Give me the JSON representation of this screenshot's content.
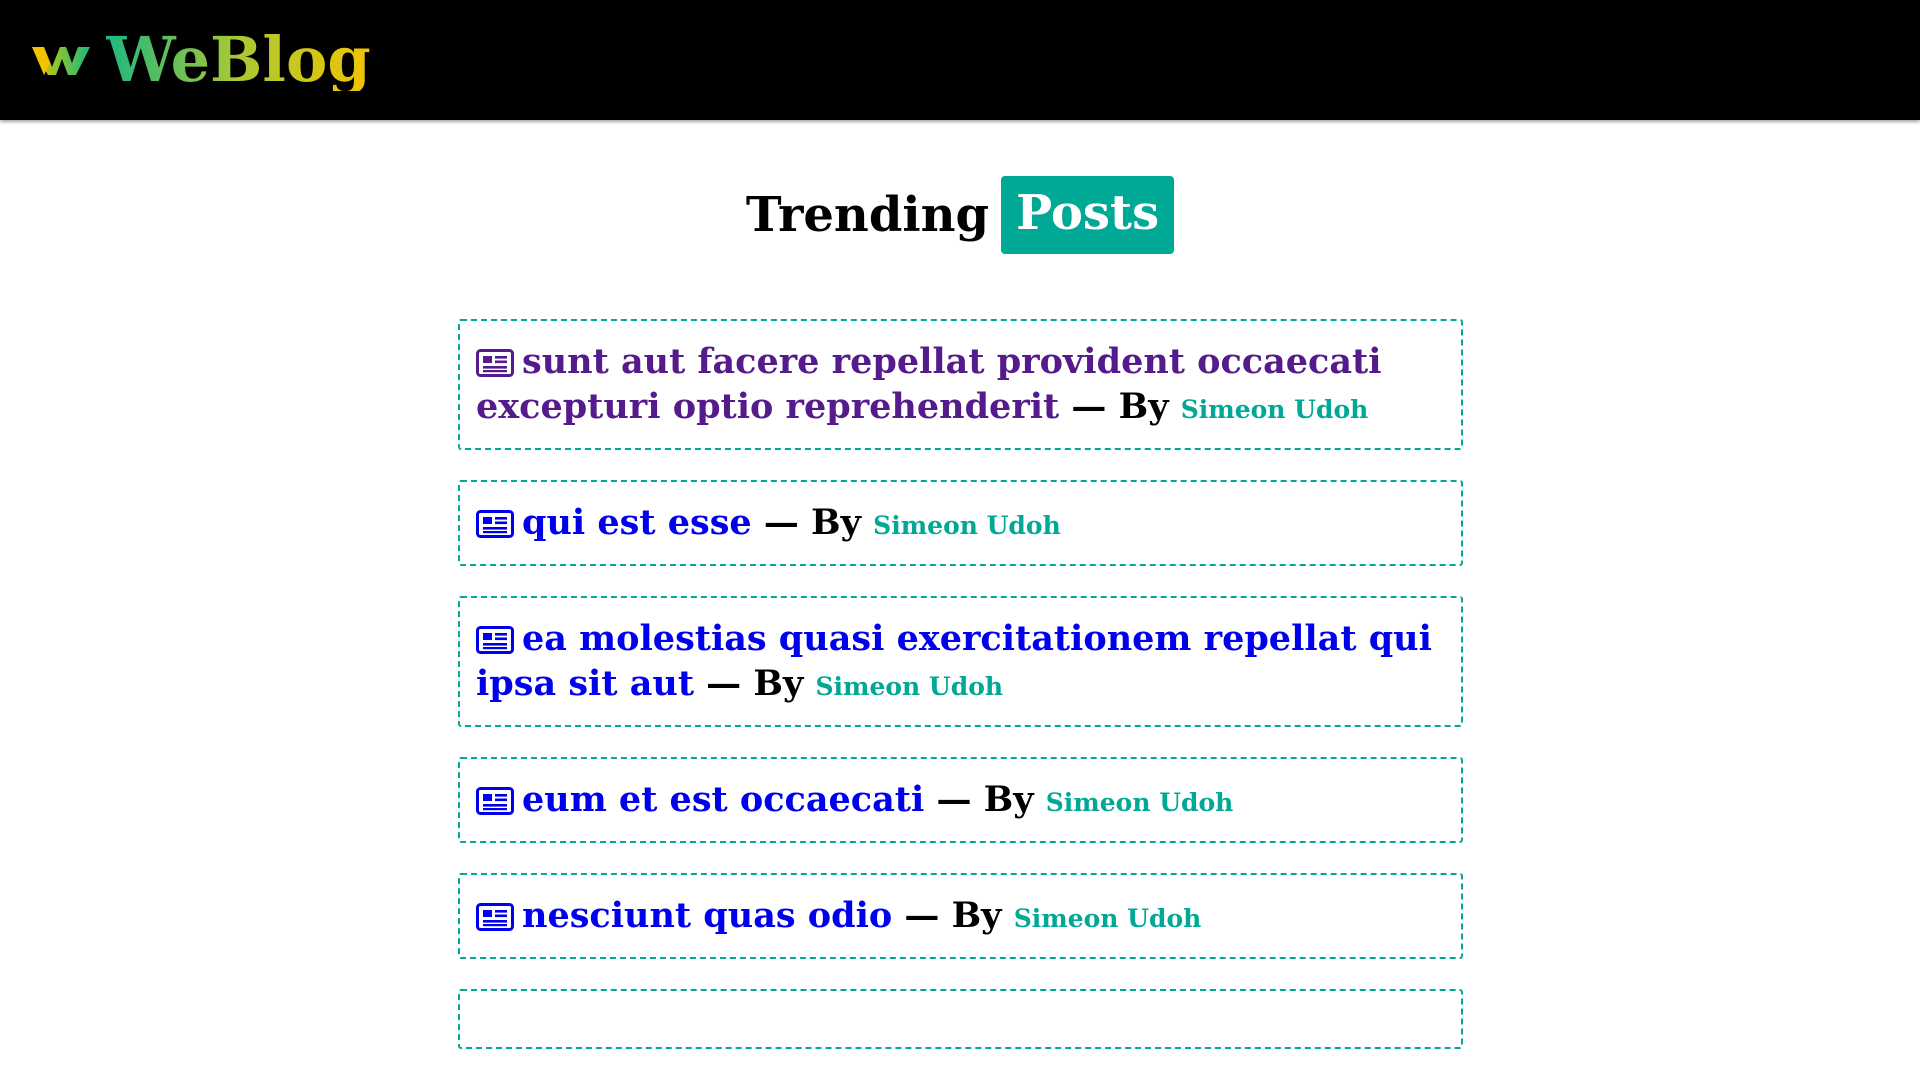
{
  "brand": {
    "name": "WeBlog",
    "logo_icon": "weblog-w-logo-icon"
  },
  "heading": {
    "word": "Trending",
    "badge": "Posts"
  },
  "colors": {
    "navbar": "#000000",
    "accent": "#00a896",
    "link": "#0000ee",
    "visited_link": "#551a8b"
  },
  "posts": [
    {
      "title": "sunt aut facere repellat provident occaecati excepturi optio reprehenderit",
      "separator": "— By",
      "author": "Simeon Udoh",
      "visited": true,
      "icon": "newspaper-icon"
    },
    {
      "title": "qui est esse",
      "separator": "— By",
      "author": "Simeon Udoh",
      "visited": false,
      "icon": "newspaper-icon"
    },
    {
      "title": "ea molestias quasi exercitationem repellat qui ipsa sit aut",
      "separator": "— By",
      "author": "Simeon Udoh",
      "visited": false,
      "icon": "newspaper-icon"
    },
    {
      "title": "eum et est occaecati",
      "separator": "— By",
      "author": "Simeon Udoh",
      "visited": false,
      "icon": "newspaper-icon"
    },
    {
      "title": "nesciunt quas odio",
      "separator": "— By",
      "author": "Simeon Udoh",
      "visited": false,
      "icon": "newspaper-icon"
    }
  ]
}
